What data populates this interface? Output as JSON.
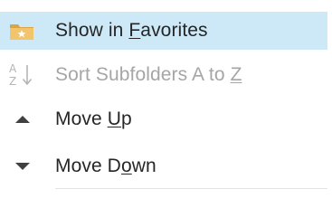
{
  "menu": {
    "items": [
      {
        "label_before": "Show in ",
        "mnemonic": "F",
        "label_after": "avorites",
        "icon": "favorites-folder-icon",
        "enabled": true,
        "highlighted": true
      },
      {
        "label_before": "Sort Subfolders A to ",
        "mnemonic": "Z",
        "label_after": "",
        "icon": "sort-az-icon",
        "enabled": false,
        "highlighted": false
      },
      {
        "label_before": "Move ",
        "mnemonic": "U",
        "label_after": "p",
        "icon": "triangle-up-icon",
        "enabled": true,
        "highlighted": false
      },
      {
        "label_before": "Move D",
        "mnemonic": "o",
        "label_after": "wn",
        "icon": "triangle-down-icon",
        "enabled": true,
        "highlighted": false
      }
    ],
    "colors": {
      "highlight": "#cde8f7",
      "text": "#262626",
      "disabled_text": "#a6a6a6",
      "folder": "#f2c46b",
      "folder_dark": "#d9a441",
      "star": "#ffffff",
      "arrow": "#404040"
    }
  }
}
